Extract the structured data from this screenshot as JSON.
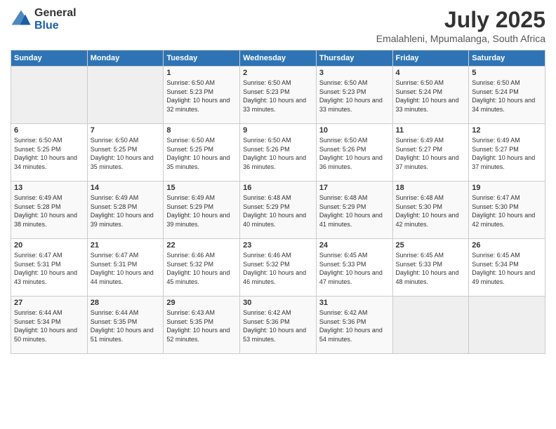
{
  "logo": {
    "general": "General",
    "blue": "Blue"
  },
  "title": "July 2025",
  "subtitle": "Emalahleni, Mpumalanga, South Africa",
  "days_header": [
    "Sunday",
    "Monday",
    "Tuesday",
    "Wednesday",
    "Thursday",
    "Friday",
    "Saturday"
  ],
  "weeks": [
    [
      {
        "day": "",
        "info": ""
      },
      {
        "day": "",
        "info": ""
      },
      {
        "day": "1",
        "info": "Sunrise: 6:50 AM\nSunset: 5:23 PM\nDaylight: 10 hours and 32 minutes."
      },
      {
        "day": "2",
        "info": "Sunrise: 6:50 AM\nSunset: 5:23 PM\nDaylight: 10 hours and 33 minutes."
      },
      {
        "day": "3",
        "info": "Sunrise: 6:50 AM\nSunset: 5:23 PM\nDaylight: 10 hours and 33 minutes."
      },
      {
        "day": "4",
        "info": "Sunrise: 6:50 AM\nSunset: 5:24 PM\nDaylight: 10 hours and 33 minutes."
      },
      {
        "day": "5",
        "info": "Sunrise: 6:50 AM\nSunset: 5:24 PM\nDaylight: 10 hours and 34 minutes."
      }
    ],
    [
      {
        "day": "6",
        "info": "Sunrise: 6:50 AM\nSunset: 5:25 PM\nDaylight: 10 hours and 34 minutes."
      },
      {
        "day": "7",
        "info": "Sunrise: 6:50 AM\nSunset: 5:25 PM\nDaylight: 10 hours and 35 minutes."
      },
      {
        "day": "8",
        "info": "Sunrise: 6:50 AM\nSunset: 5:25 PM\nDaylight: 10 hours and 35 minutes."
      },
      {
        "day": "9",
        "info": "Sunrise: 6:50 AM\nSunset: 5:26 PM\nDaylight: 10 hours and 36 minutes."
      },
      {
        "day": "10",
        "info": "Sunrise: 6:50 AM\nSunset: 5:26 PM\nDaylight: 10 hours and 36 minutes."
      },
      {
        "day": "11",
        "info": "Sunrise: 6:49 AM\nSunset: 5:27 PM\nDaylight: 10 hours and 37 minutes."
      },
      {
        "day": "12",
        "info": "Sunrise: 6:49 AM\nSunset: 5:27 PM\nDaylight: 10 hours and 37 minutes."
      }
    ],
    [
      {
        "day": "13",
        "info": "Sunrise: 6:49 AM\nSunset: 5:28 PM\nDaylight: 10 hours and 38 minutes."
      },
      {
        "day": "14",
        "info": "Sunrise: 6:49 AM\nSunset: 5:28 PM\nDaylight: 10 hours and 39 minutes."
      },
      {
        "day": "15",
        "info": "Sunrise: 6:49 AM\nSunset: 5:29 PM\nDaylight: 10 hours and 39 minutes."
      },
      {
        "day": "16",
        "info": "Sunrise: 6:48 AM\nSunset: 5:29 PM\nDaylight: 10 hours and 40 minutes."
      },
      {
        "day": "17",
        "info": "Sunrise: 6:48 AM\nSunset: 5:29 PM\nDaylight: 10 hours and 41 minutes."
      },
      {
        "day": "18",
        "info": "Sunrise: 6:48 AM\nSunset: 5:30 PM\nDaylight: 10 hours and 42 minutes."
      },
      {
        "day": "19",
        "info": "Sunrise: 6:47 AM\nSunset: 5:30 PM\nDaylight: 10 hours and 42 minutes."
      }
    ],
    [
      {
        "day": "20",
        "info": "Sunrise: 6:47 AM\nSunset: 5:31 PM\nDaylight: 10 hours and 43 minutes."
      },
      {
        "day": "21",
        "info": "Sunrise: 6:47 AM\nSunset: 5:31 PM\nDaylight: 10 hours and 44 minutes."
      },
      {
        "day": "22",
        "info": "Sunrise: 6:46 AM\nSunset: 5:32 PM\nDaylight: 10 hours and 45 minutes."
      },
      {
        "day": "23",
        "info": "Sunrise: 6:46 AM\nSunset: 5:32 PM\nDaylight: 10 hours and 46 minutes."
      },
      {
        "day": "24",
        "info": "Sunrise: 6:45 AM\nSunset: 5:33 PM\nDaylight: 10 hours and 47 minutes."
      },
      {
        "day": "25",
        "info": "Sunrise: 6:45 AM\nSunset: 5:33 PM\nDaylight: 10 hours and 48 minutes."
      },
      {
        "day": "26",
        "info": "Sunrise: 6:45 AM\nSunset: 5:34 PM\nDaylight: 10 hours and 49 minutes."
      }
    ],
    [
      {
        "day": "27",
        "info": "Sunrise: 6:44 AM\nSunset: 5:34 PM\nDaylight: 10 hours and 50 minutes."
      },
      {
        "day": "28",
        "info": "Sunrise: 6:44 AM\nSunset: 5:35 PM\nDaylight: 10 hours and 51 minutes."
      },
      {
        "day": "29",
        "info": "Sunrise: 6:43 AM\nSunset: 5:35 PM\nDaylight: 10 hours and 52 minutes."
      },
      {
        "day": "30",
        "info": "Sunrise: 6:42 AM\nSunset: 5:36 PM\nDaylight: 10 hours and 53 minutes."
      },
      {
        "day": "31",
        "info": "Sunrise: 6:42 AM\nSunset: 5:36 PM\nDaylight: 10 hours and 54 minutes."
      },
      {
        "day": "",
        "info": ""
      },
      {
        "day": "",
        "info": ""
      }
    ]
  ]
}
